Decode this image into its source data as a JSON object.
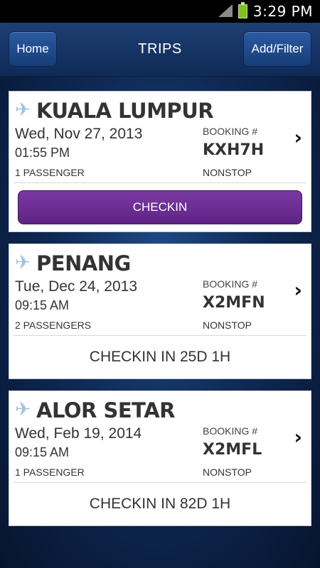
{
  "status_bar": {
    "time": "3:29 PM"
  },
  "header": {
    "home_label": "Home",
    "title": "TRIPS",
    "add_filter_label": "Add/Filter"
  },
  "trips": [
    {
      "city": "KUALA LUMPUR",
      "date": "Wed, Nov 27, 2013",
      "time": "01:55 PM",
      "passengers": "1 PASSENGER",
      "booking_label": "BOOKING #",
      "booking_code": "KXH7H",
      "stops": "NONSTOP",
      "action": "CHECKIN"
    },
    {
      "city": "PENANG",
      "date": "Tue, Dec 24, 2013",
      "time": "09:15 AM",
      "passengers": "2 PASSENGERS",
      "booking_label": "BOOKING #",
      "booking_code": "X2MFN",
      "stops": "NONSTOP",
      "action": "CHECKIN IN 25D 1H"
    },
    {
      "city": "ALOR SETAR",
      "date": "Wed, Feb 19, 2014",
      "time": "09:15 AM",
      "passengers": "1 PASSENGER",
      "booking_label": "BOOKING #",
      "booking_code": "X2MFL",
      "stops": "NONSTOP",
      "action": "CHECKIN IN 82D 1H"
    }
  ],
  "icons": {
    "plane": "airplane-icon",
    "chevron": "chevron-right-icon"
  },
  "colors": {
    "accent_purple": "#6a2b92",
    "header_blue": "#163d78"
  }
}
